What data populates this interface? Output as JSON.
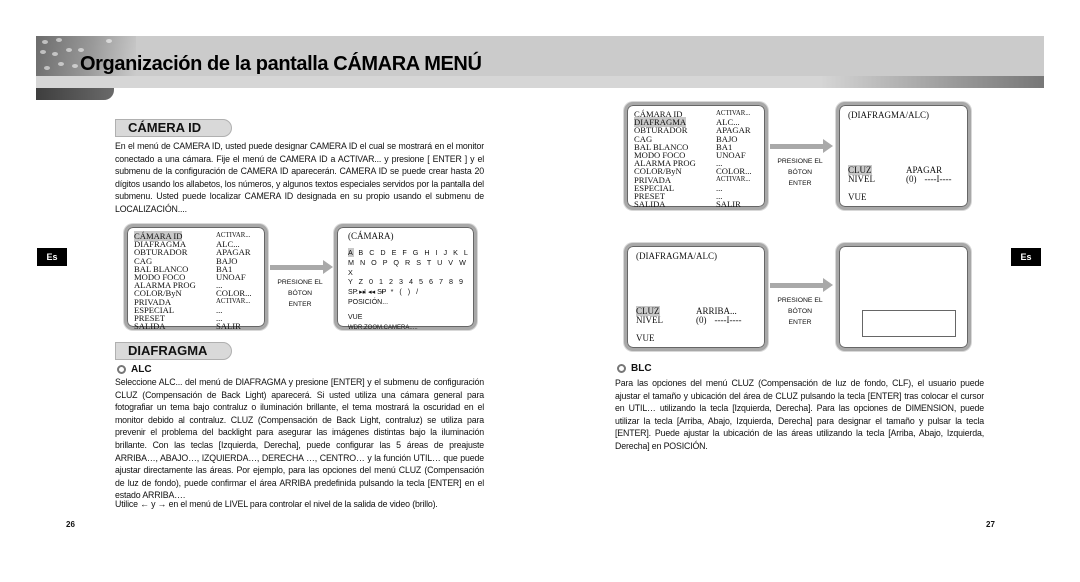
{
  "header": {
    "title": "Organización de la pantalla CÁMARA MENÚ"
  },
  "language_tab": "Es",
  "left_page": {
    "section_camera_id": {
      "title": "CÁMERA ID",
      "body": "En el menú de CAMERA ID, usted puede designar CAMERA ID el cual se mostrará en el monitor conectado a una cámara. Fije el menú de CAMERA ID a ACTIVAR... y presione [ ENTER ] y el submenu de la configuración de CAMERA ID aparecerán. CAMERA ID se puede crear hasta 20 dígitos usando los allabetos, los números, y algunos textos especiales servidos por la pantalla del submenu. Usted puede localizar CAMERA ID designada en su propio usando el submenu de LOCALIZACIÓN...."
    },
    "main_menu": {
      "rows": [
        {
          "key": "CÁMARA ID",
          "value": "ACTIVAR...",
          "highlight": true,
          "small": true
        },
        {
          "key": "DIAFRAGMA",
          "value": "ALC...",
          "highlight": false,
          "small": false
        },
        {
          "key": "OBTURADOR",
          "value": "APAGAR",
          "highlight": false,
          "small": false
        },
        {
          "key": "CAG",
          "value": "BAJO",
          "highlight": false,
          "small": false
        },
        {
          "key": "BAL BLANCO",
          "value": "BA1",
          "highlight": false,
          "small": false
        },
        {
          "key": "MODO FOCO",
          "value": "UNOAF",
          "highlight": false,
          "small": false
        },
        {
          "key": "ALARMA PROG",
          "value": "...",
          "highlight": false,
          "small": false
        },
        {
          "key": "COLOR/ByN",
          "value": "COLOR...",
          "highlight": false,
          "small": false
        },
        {
          "key": "PRIVADA",
          "value": "ACTIVAR...",
          "highlight": false,
          "small": true
        },
        {
          "key": "ESPECIAL",
          "value": "...",
          "highlight": false,
          "small": false
        },
        {
          "key": "PRESET",
          "value": "...",
          "highlight": false,
          "small": false
        },
        {
          "key": "SALIDA",
          "value": "SALIR",
          "highlight": false,
          "small": false
        }
      ]
    },
    "press_label": [
      "PRESIONE EL",
      "BÓTON",
      "ENTER"
    ],
    "camera_screen": {
      "title": "(CÁMARA)",
      "charset_rows": [
        "A B C D E F G H I J K L",
        "M N O P Q R S T U V W X",
        "Y Z 0 1 2 3 4 5 6 7 8 9",
        "  : ! - + * ( ) /"
      ],
      "selected_char": "A",
      "sp_line": "SP ▸▸ ◂◂ SP",
      "position": "POSICIÓN...",
      "vue": "VUE",
      "footer": "WDR.ZOOM.CAMERA....."
    },
    "section_diafragma": {
      "title": "DIAFRAGMA",
      "alc_label": "ALC",
      "body": "Seleccione ALC... del menú de DIAFRAGMA y presione [ENTER] y el submenu de configuración CLUZ (Compensación de Back Light) aparecerá. Si usted utiliza una cámara general para fotografiar un tema bajo contraluz o iluminación brillante, el tema mostrará la oscuridad en el monitor debido al contraluz. CLUZ (Compensación de Back Light, contraluz) se utiliza para prevenir el problema del backlight para asegurar las imágenes distintas bajo la iluminación brillante. Con las teclas [Izquierda, Derecha], puede configurar las 5 áreas de preajuste ARRIBA…, ABAJO…, IZQUIERDA…, DERECHA …, CENTRO… y la función UTIL… que puede ajustar directamente las áreas. Por ejemplo, para las opciones del menú CLUZ (Compensación de luz de fondo), puede confirmar el área ARRIBA predefinida pulsando la tecla [ENTER] en el estado ARRIBA….",
      "level_note": "Utilice ← y → en el menú de LIVEL para controlar el nivel de la salida de video (brillo)."
    },
    "page_number": "26"
  },
  "right_page": {
    "main_menu": {
      "rows": [
        {
          "key": "CÁMARA ID",
          "value": "ACTIVAR...",
          "highlight": false,
          "small": true
        },
        {
          "key": "DIAFRAGMA",
          "value": "ALC...",
          "highlight": true,
          "small": false
        },
        {
          "key": "OBTURADOR",
          "value": "APAGAR",
          "highlight": false,
          "small": false
        },
        {
          "key": "CAG",
          "value": "BAJO",
          "highlight": false,
          "small": false
        },
        {
          "key": "BAL BLANCO",
          "value": "BA1",
          "highlight": false,
          "small": false
        },
        {
          "key": "MODO FOCO",
          "value": "UNOAF",
          "highlight": false,
          "small": false
        },
        {
          "key": "ALARMA PROG",
          "value": "...",
          "highlight": false,
          "small": false
        },
        {
          "key": "COLOR/ByN",
          "value": "COLOR...",
          "highlight": false,
          "small": false
        },
        {
          "key": "PRIVADA",
          "value": "ACTIVAR...",
          "highlight": false,
          "small": true
        },
        {
          "key": "ESPECIAL",
          "value": "...",
          "highlight": false,
          "small": false
        },
        {
          "key": "PRESET",
          "value": "...",
          "highlight": false,
          "small": false
        },
        {
          "key": "SALIDA",
          "value": "SALIR",
          "highlight": false,
          "small": false
        }
      ]
    },
    "press_label": [
      "PRESIONE EL",
      "BÓTON",
      "ENTER"
    ],
    "alc_screen_1": {
      "title": "(DIAFRAGMA/ALC)",
      "cluz_label": "CLUZ",
      "cluz_value": "APAGAR",
      "nivel_label": "NIVEL",
      "nivel_value": "(0)",
      "nivel_bar": "----I----",
      "vue": "VUE"
    },
    "alc_screen_2": {
      "title": "(DIAFRAGMA/ALC)",
      "cluz_label": "CLUZ",
      "cluz_value": "ARRIBA...",
      "nivel_label": "NIVEL",
      "nivel_value": "(0)",
      "nivel_bar": "----I----",
      "vue": "VUE"
    },
    "blc": {
      "label": "BLC",
      "body": "Para las opciones del menú CLUZ (Compensación de luz de fondo, CLF), el usuario puede ajustar el tamaño y ubicación del área de CLUZ pulsando la tecla [ENTER] tras colocar el cursor en UTIL… utilizando la tecla [Izquierda, Derecha]. Para las opciones de DIMENSION, puede utilizar la tecla [Arriba, Abajo, Izquierda, Derecha] para designar el tamaño y pulsar la tecla [ENTER]. Puede ajustar la ubicación de las áreas utilizando la tecla [Arriba, Abajo, Izquierda, Derecha] en POSICIÓN."
    },
    "page_number": "27"
  }
}
